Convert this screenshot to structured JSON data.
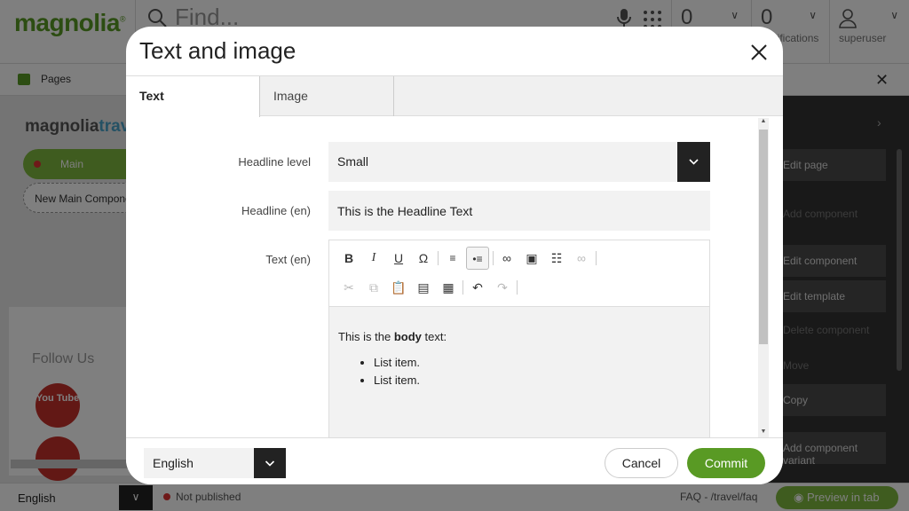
{
  "app": {
    "logo": "magnolia",
    "search_placeholder": "Find...",
    "tasks_count": "0",
    "notifications_count": "0",
    "notifications_label": "Notifications",
    "user_label": "superuser",
    "subapp_label": "Pages",
    "preview_logo_a": "magnolia",
    "preview_logo_b": "travel",
    "area_main": "Main",
    "new_component": "New Main Component",
    "follow_us": "Follow Us",
    "youtube": "You Tube",
    "right_actions": [
      "Edit page",
      "Add component",
      "Edit component",
      "Edit template",
      "Delete component",
      "Move",
      "Copy",
      "Add component variant"
    ],
    "footer": {
      "language": "English",
      "status": "Not published",
      "path": "FAQ - /travel/faq",
      "preview_button": "Preview in tab"
    }
  },
  "dialog": {
    "title": "Text and image",
    "tabs": [
      "Text",
      "Image"
    ],
    "fields": {
      "headline_level_label": "Headline level",
      "headline_level_value": "Small",
      "headline_label": "Headline (en)",
      "headline_value": "This is the Headline Text",
      "text_label": "Text (en)"
    },
    "editor": {
      "text_before": "This is the ",
      "text_bold": "body",
      "text_after": " text:",
      "list_items": [
        "List item.",
        "List item."
      ]
    },
    "footer": {
      "language": "English",
      "cancel": "Cancel",
      "commit": "Commit"
    },
    "accent_color": "#599a24"
  }
}
